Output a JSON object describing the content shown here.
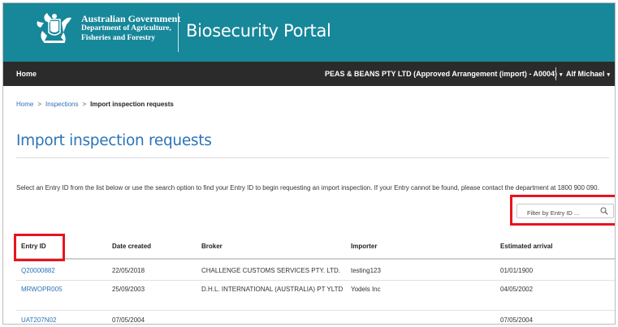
{
  "header": {
    "gov_title": "Australian Government",
    "dept_line1": "Department of Agriculture,",
    "dept_line2": "Fisheries and Forestry",
    "portal_title": "Biosecurity Portal"
  },
  "nav": {
    "home": "Home",
    "organisation": "PEAS & BEANS PTY LTD (Approved Arrangement (import) - A0004)",
    "user": "Alf Michael",
    "caret": "▾"
  },
  "breadcrumb": {
    "home": "Home",
    "inspections": "Inspections",
    "current": "Import inspection requests",
    "separator": ">"
  },
  "page": {
    "title": "Import inspection requests",
    "intro": "Select an Entry ID from the list below or use the search option to find your Entry ID to begin requesting an import inspection. If your Entry cannot be found, please contact the department at 1800 900 090."
  },
  "filter": {
    "placeholder": "Filter by Entry ID ..."
  },
  "table": {
    "columns": [
      "Entry ID",
      "Date created",
      "Broker",
      "Importer",
      "Estimated arrival"
    ],
    "rows": [
      [
        "Q20000882",
        "22/05/2018",
        "CHALLENGE CUSTOMS SERVICES PTY. LTD.",
        "testing123",
        "01/01/1900"
      ],
      [
        "MRWOPR005",
        "25/09/2003",
        "D.H.L. INTERNATIONAL (AUSTRALIA) PT YLTD",
        "Yodels Inc",
        "04/05/2002"
      ],
      [
        "UAT207N02",
        "07/05/2004",
        "",
        "",
        "07/05/2004"
      ]
    ]
  },
  "colors": {
    "header_teal": "#17879a",
    "nav_dark": "#2b2b2b",
    "link_blue": "#2c73b8",
    "highlight_red": "#e8141e"
  }
}
